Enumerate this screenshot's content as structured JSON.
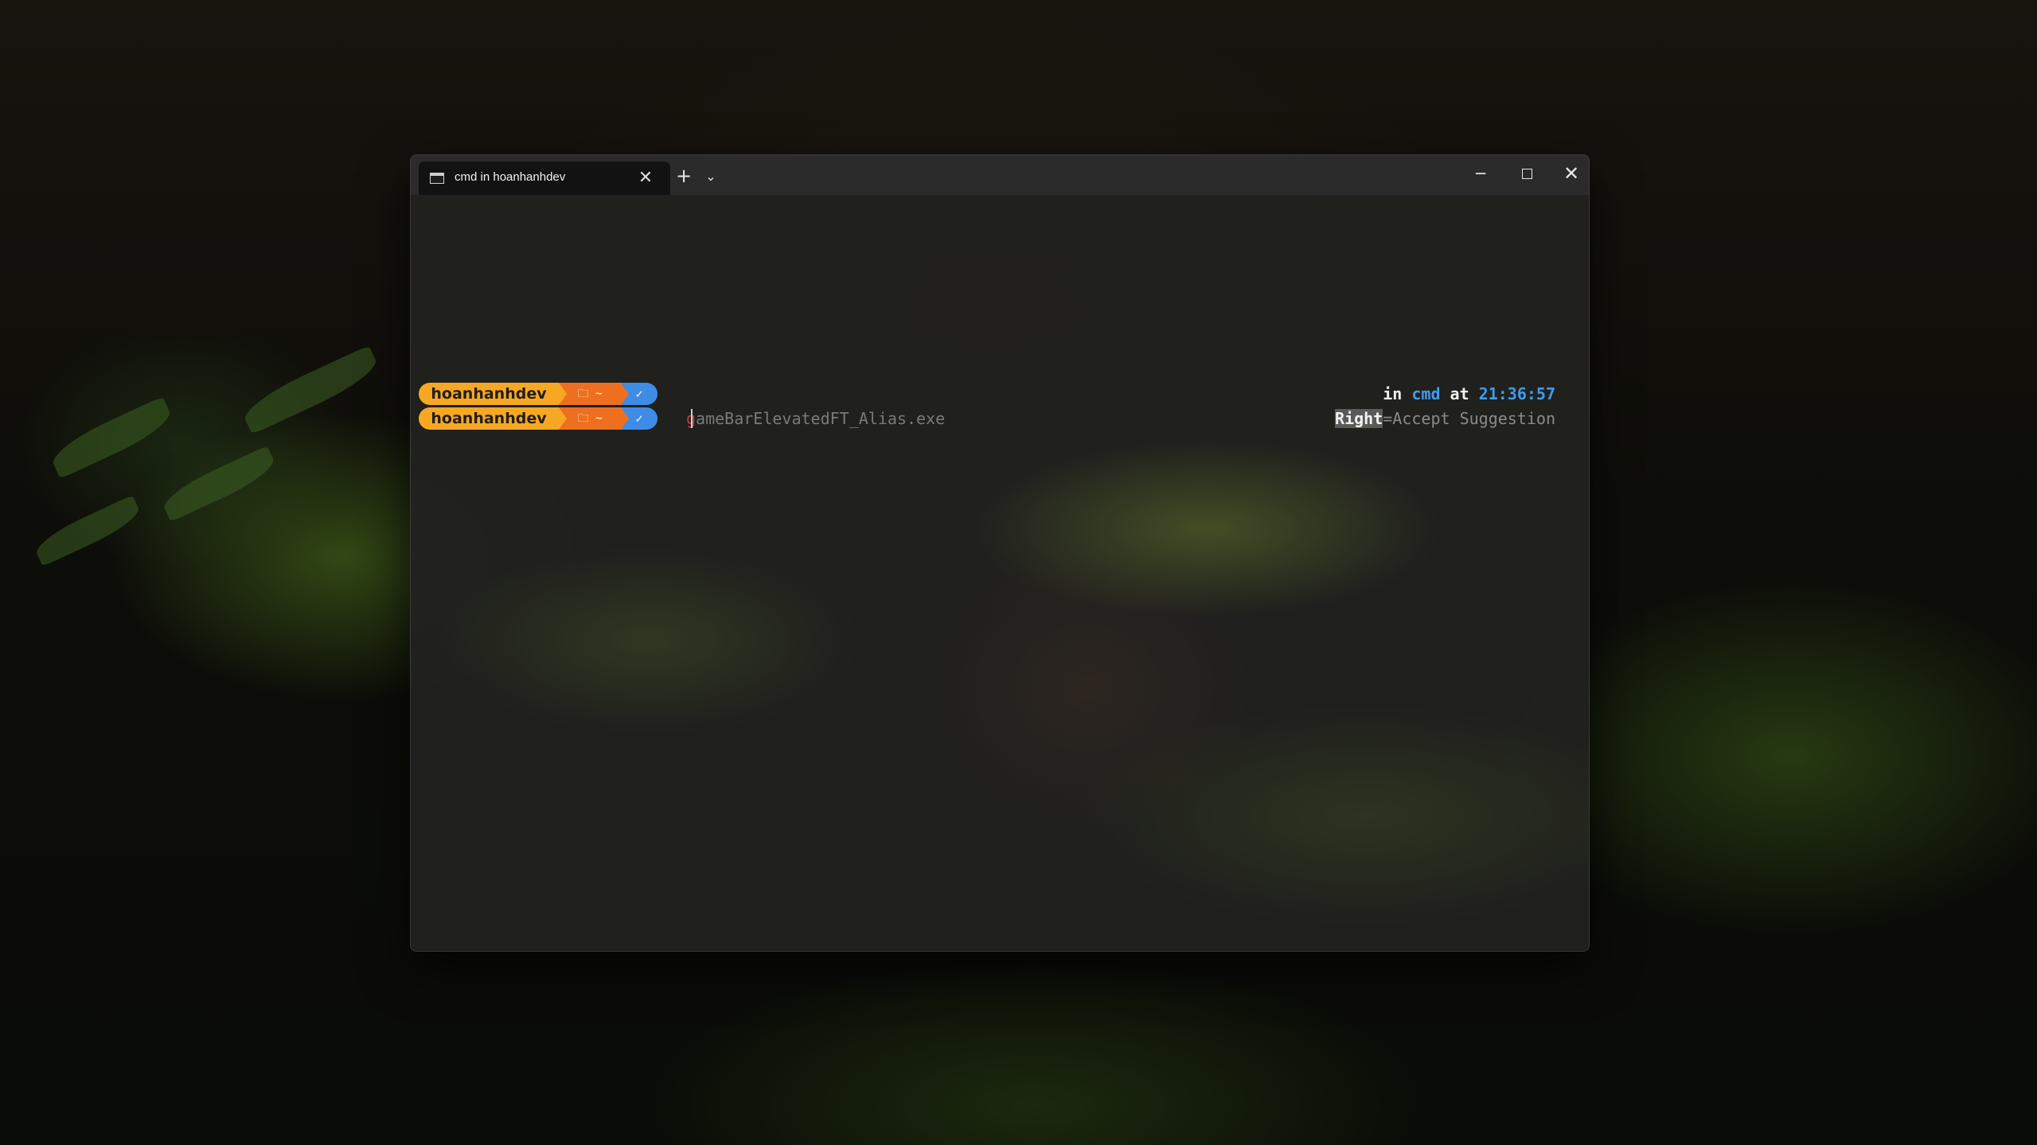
{
  "window": {
    "tab_title": "cmd in hoanhanhdev",
    "tab_close_glyph": "✕",
    "new_tab_glyph": "+",
    "dropdown_glyph": "⌄",
    "minimize_glyph": "─",
    "close_glyph": "✕"
  },
  "prompt": {
    "rows": [
      {
        "user": "hoanhanhdev",
        "path": "🗀 ~",
        "status": "✓"
      },
      {
        "user": "hoanhanhdev",
        "path": "🗀 ~",
        "status": "✓"
      }
    ],
    "colors": {
      "user": "#f7a823",
      "path": "#ee6f1f",
      "status": "#3f8ce6"
    }
  },
  "rprompt": {
    "in_word": "in",
    "shell": "cmd",
    "at_word": "at",
    "time": "21:36:57"
  },
  "input": {
    "typed": "g",
    "suggestion_rest": "ameBarElevatedFT_Alias.exe"
  },
  "hint": {
    "key": "Right",
    "text": "=Accept Suggestion"
  }
}
